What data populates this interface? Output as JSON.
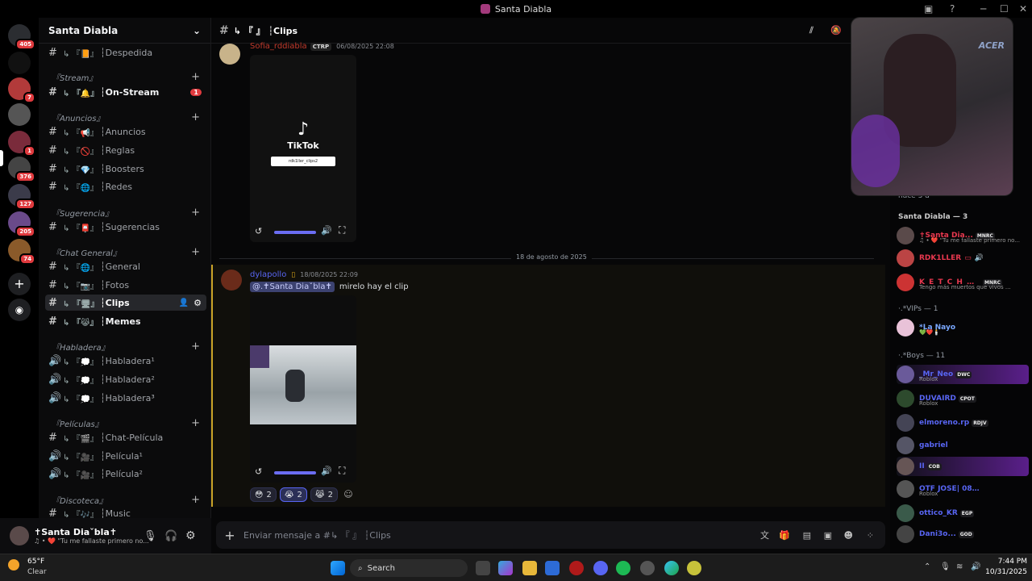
{
  "window": {
    "title": "Santa Diabla"
  },
  "servers": [
    {
      "badge": "405"
    },
    {
      "badge": ""
    },
    {
      "badge": "7"
    },
    {
      "badge": ""
    },
    {
      "badge": "1"
    },
    {
      "badge": "376"
    },
    {
      "badge": "127"
    },
    {
      "badge": "205"
    },
    {
      "badge": "74"
    }
  ],
  "guild": {
    "name": "Santa Diabla"
  },
  "channels": {
    "despedida": "┆Despedida",
    "cat_stream": "『Stream』",
    "onstream": "┆On-Stream",
    "onstream_badge": "1",
    "cat_anuncios": "『Anuncios』",
    "anuncios": "┆Anuncios",
    "reglas": "┆Reglas",
    "boosters": "┆Boosters",
    "redes": "┆Redes",
    "cat_sugerencia": "『Sugerencia』",
    "sugerencias": "┆Sugerencias",
    "cat_chat": "『Chat General』",
    "general": "┆General",
    "fotos": "┆Fotos",
    "clips": "┆Clips",
    "memes": "┆Memes",
    "cat_habladera": "『Habladera』",
    "habladera1": "┆Habladera¹",
    "habladera2": "┆Habladera²",
    "habladera3": "┆Habladera³",
    "cat_peliculas": "『Películas』",
    "chat_pelicula": "┆Chat-Película",
    "pelicula1": "┆Película¹",
    "pelicula2": "┆Película²",
    "cat_discoteca": "『Discoteca』",
    "music": "┆Music"
  },
  "user": {
    "name": "✝Santa Diaˇbla✝",
    "status": "♫ • ❤️ \"Tu me fallaste primero no..."
  },
  "header": {
    "channel": "↳ 『  』 ┆Clips"
  },
  "messages": [
    {
      "author": "Sofia_rddiabla",
      "tag": "CTRP",
      "time": "06/08/2025 22:08",
      "tiktok": "TikTok",
      "tiktok_search": "rdk1ller_clips2"
    },
    {
      "divider": "18 de agosto de 2025"
    },
    {
      "author": "dylapollo",
      "time": "18/08/2025 22:09",
      "mention": "@.✝Santa Diaˇbla✝",
      "text": "mirelo hay el clip",
      "reactions": [
        {
          "emoji": "😳",
          "count": "2"
        },
        {
          "emoji": "😭",
          "count": "2"
        },
        {
          "emoji": "😹",
          "count": "2"
        }
      ]
    }
  ],
  "composer": {
    "placeholder": "Enviar mensaje a #↳ 『  』 ┆Clips"
  },
  "members": {
    "recent": "hace 3 d",
    "group1": "Santa Diabla — 3",
    "list1": [
      {
        "name": "✝Santa Dia...",
        "tag": "MNRC",
        "sub": "♫ • ❤️ \"Tu me fallaste primero no...",
        "color": "#e8384f"
      },
      {
        "name": "RDK1LLER",
        "tag": "",
        "sub": "",
        "color": "#e8384f"
      },
      {
        "name": "K E T C H U P",
        "tag": "MNRC",
        "sub": "Tengo más muertos que vivos ...",
        "color": "#e8384f"
      }
    ],
    "group2": "·.*VIPs — 1",
    "list2": [
      {
        "name": "*La Nayo",
        "sub": "💚❤️🕯️",
        "color": "#7aa8ff"
      }
    ],
    "group3": "·.*Boys — 11",
    "list3": [
      {
        "name": "_Mr_Neo",
        "tag": "DWC",
        "sub": "Roblox",
        "color": "#5865f2"
      },
      {
        "name": "DUVAIRD",
        "tag": "CPOT",
        "sub": "Roblox",
        "color": "#5865f2"
      },
      {
        "name": "elmoreno.rp",
        "tag": "RDJV",
        "sub": "",
        "color": "#5865f2"
      },
      {
        "name": "gabriel",
        "tag": "",
        "sub": "",
        "color": "#5865f2"
      },
      {
        "name": "II",
        "tag": "COB",
        "sub": "",
        "color": "#5865f2"
      },
      {
        "name": "OTF JOSE| 0800 ON T...",
        "tag": "",
        "sub": "Roblox",
        "color": "#5865f2"
      },
      {
        "name": "ottico_KR",
        "tag": "EGP",
        "sub": "",
        "color": "#5865f2"
      },
      {
        "name": "Dani3o...",
        "tag": "GOD",
        "sub": "",
        "color": "#5865f2"
      }
    ]
  },
  "taskbar": {
    "weather_temp": "65°F",
    "weather_desc": "Clear",
    "search": "Search",
    "time": "7:44 PM",
    "date": "10/31/2025"
  },
  "colors": {
    "accent": "#5865f2",
    "danger": "#e03a3e",
    "bg": "#070708"
  }
}
